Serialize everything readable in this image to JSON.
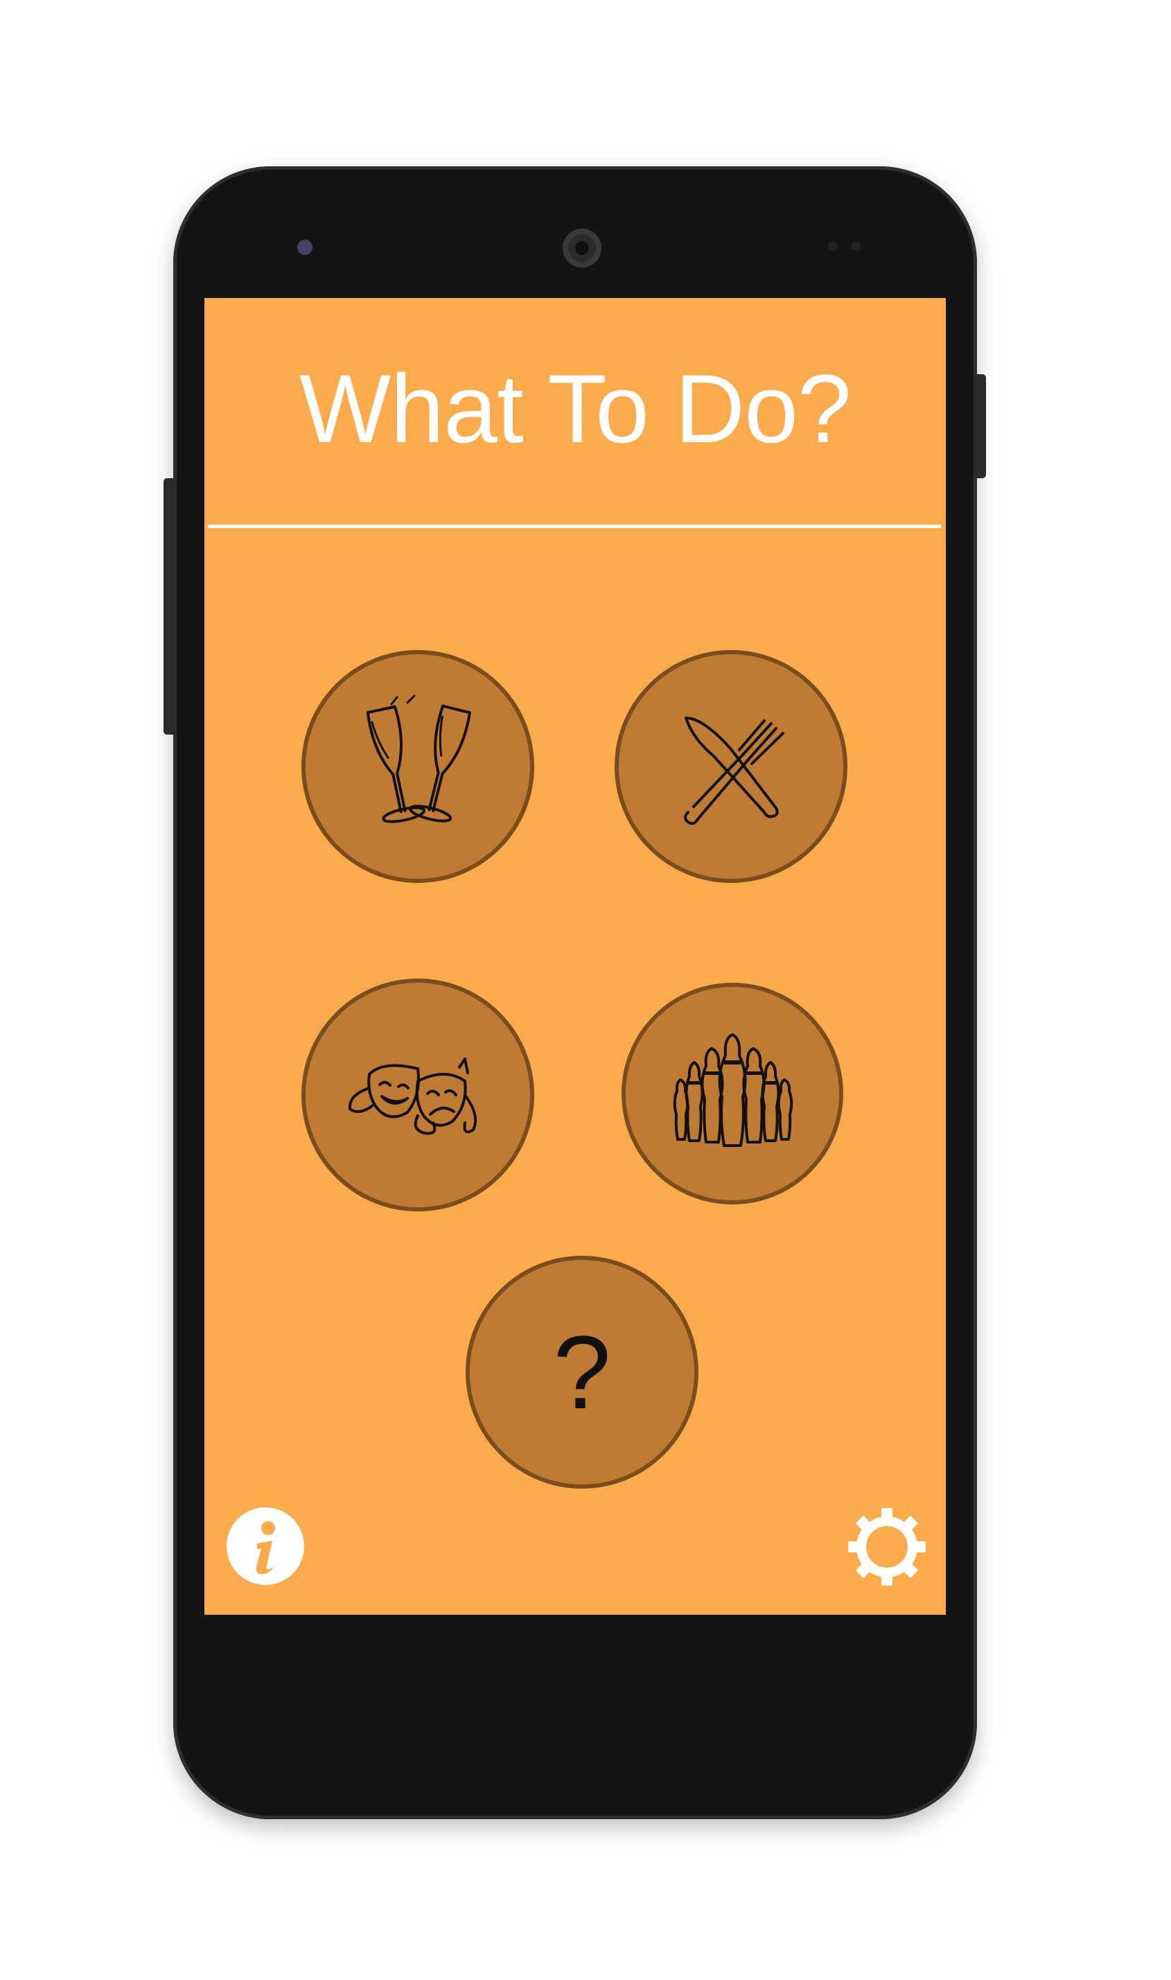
{
  "app": {
    "title": "What To Do?"
  },
  "categories": [
    {
      "id": "drinks",
      "icon": "champagne-glasses-icon"
    },
    {
      "id": "food",
      "icon": "knife-fork-icon"
    },
    {
      "id": "theatre",
      "icon": "theatre-masks-icon"
    },
    {
      "id": "bowling",
      "icon": "bowling-pins-icon"
    }
  ],
  "random_button": {
    "label": "?"
  },
  "footer": {
    "info_icon": "info-icon",
    "settings_icon": "gear-icon"
  },
  "colors": {
    "screen_background": "#fbab4b",
    "button_fill": "#bf7a33",
    "button_border": "#7a4d1e",
    "title_text": "#ffffff",
    "device_body": "#141414"
  }
}
